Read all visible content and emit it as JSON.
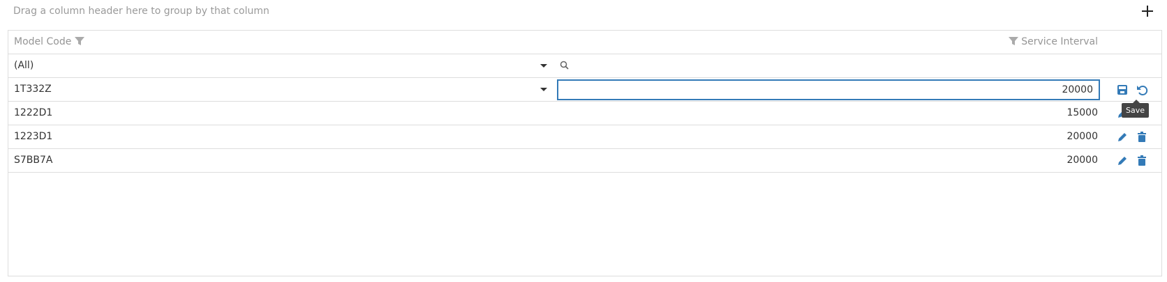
{
  "group_bar": {
    "hint": "Drag a column header here to group by that column",
    "add_icon": "plus-icon"
  },
  "columns": [
    {
      "label": "Model Code"
    },
    {
      "label": "Service Interval"
    }
  ],
  "filter_row": {
    "model_code_selected": "(All)",
    "search_icon": "search-icon"
  },
  "rows": [
    {
      "model_code": "1T332Z",
      "service_interval": "20000",
      "editing": true
    },
    {
      "model_code": "1222D1",
      "service_interval": "15000",
      "editing": false
    },
    {
      "model_code": "1223D1",
      "service_interval": "20000",
      "editing": false
    },
    {
      "model_code": "S7BB7A",
      "service_interval": "20000",
      "editing": false
    }
  ],
  "tooltip": "Save",
  "colors": {
    "accent": "#337ab7",
    "header_text": "#959595",
    "border": "#dddddd"
  }
}
